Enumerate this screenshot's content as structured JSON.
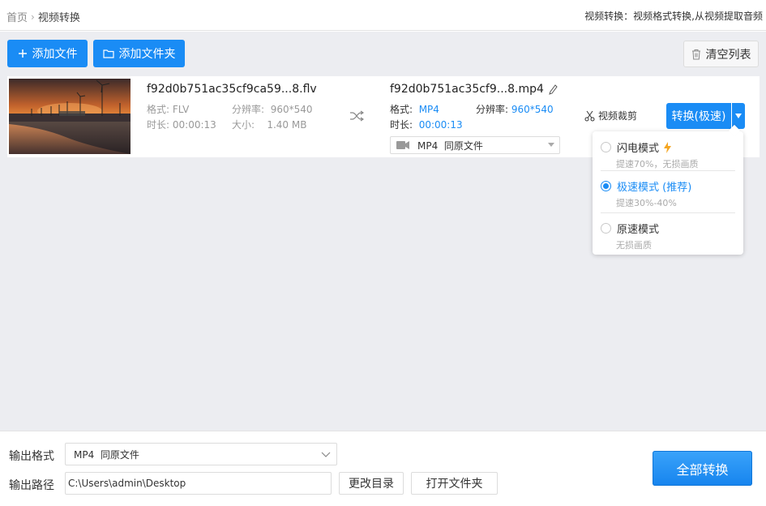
{
  "breadcrumb": {
    "home": "首页",
    "current": "视频转换"
  },
  "header_description": "视频转换：视频格式转换,从视频提取音频",
  "toolbar": {
    "add_file": "添加文件",
    "add_folder": "添加文件夹",
    "clear_list": "清空列表"
  },
  "file": {
    "source": {
      "name": "f92d0b751ac35cf9ca59...8.flv",
      "format_label": "格式:",
      "format": "FLV",
      "resolution_label": "分辨率:",
      "resolution": "960*540",
      "duration_label": "时长:",
      "duration": "00:00:13",
      "size_label": "大小:",
      "size": "1.40 MB"
    },
    "target": {
      "name": "f92d0b751ac35cf9...8.mp4",
      "format_label": "格式:",
      "format": "MP4",
      "resolution_label": "分辨率:",
      "resolution": "960*540",
      "duration_label": "时长:",
      "duration": "00:00:13",
      "format_select": "MP4  同原文件"
    },
    "cut_label": "视频裁剪",
    "convert_button": "转换(极速)"
  },
  "mode_menu": {
    "modes": [
      {
        "label": "闪电模式",
        "desc": "提速70%，无损画质",
        "selected": false
      },
      {
        "label": "极速模式 (推荐)",
        "desc": "提速30%-40%",
        "selected": true
      },
      {
        "label": "原速模式",
        "desc": "无损画质",
        "selected": false
      }
    ]
  },
  "bottom": {
    "output_format_label": "输出格式",
    "output_format_value": "MP4  同原文件",
    "output_path_label": "输出路径",
    "output_path_value": "C:\\Users\\admin\\Desktop",
    "change_dir": "更改目录",
    "open_folder": "打开文件夹",
    "convert_all": "全部转换"
  },
  "colors": {
    "accent": "#1a8cf5",
    "work_bg": "#ecedf1",
    "lightning": "#f5a623"
  },
  "icons": [
    "chevron-right-icon",
    "plus-icon",
    "folder-icon",
    "trash-icon",
    "shuffle-icon",
    "pencil-icon",
    "video-camera-icon",
    "scissors-icon",
    "dropdown-arrow-icon",
    "lightning-icon",
    "chevron-down-icon"
  ]
}
